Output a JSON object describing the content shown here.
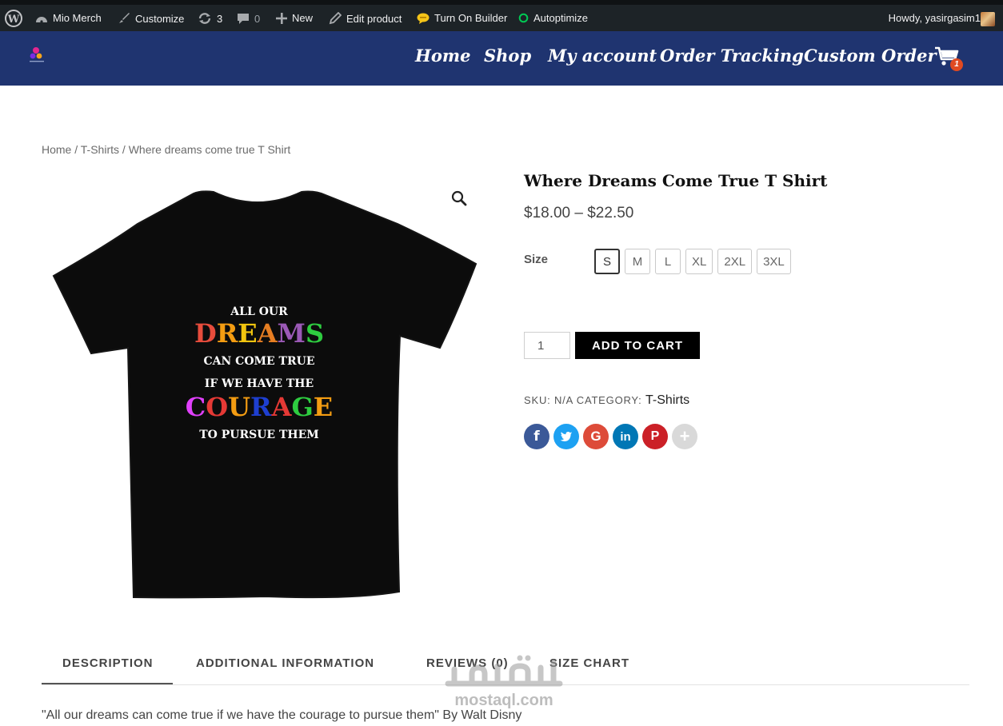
{
  "admin_bar": {
    "wp_logo": "wordpress-icon",
    "site_name": "Mio Merch",
    "customize": "Customize",
    "updates_count": "3",
    "comments_count": "0",
    "new": "New",
    "edit_product": "Edit product",
    "builder": "Turn On Builder",
    "autoptimize": "Autoptimize",
    "howdy": "Howdy, yasirgasim1"
  },
  "nav": {
    "items": [
      "Home",
      "Shop",
      "My account",
      "Order Tracking",
      "Custom Order"
    ],
    "cart_count": "1",
    "cart_icon": "shopping-cart-icon"
  },
  "breadcrumb": {
    "home": "Home",
    "sep": " / ",
    "category": "T-Shirts",
    "current": "Where dreams come true T Shirt"
  },
  "product": {
    "image_text": {
      "line1": "ALL OUR",
      "line2": [
        "D",
        "R",
        "E",
        "A",
        "M",
        "S"
      ],
      "line3": "CAN COME TRUE",
      "line4": "IF WE HAVE THE",
      "line5": [
        "C",
        "O",
        "U",
        "R",
        "A",
        "G",
        "E"
      ],
      "line6": "TO PURSUE THEM"
    },
    "title": "Where Dreams Come True T Shirt",
    "price": "$18.00 – $22.50",
    "size_label": "Size",
    "sizes": [
      "S",
      "M",
      "L",
      "XL",
      "2XL",
      "3XL"
    ],
    "selected_size": "S",
    "quantity": "1",
    "add_to_cart": "ADD TO CART",
    "sku_label": "SKU:",
    "sku_value": "N/A",
    "category_label": "CATEGORY:",
    "category_value": "T-Shirts"
  },
  "share": [
    {
      "icon": "facebook-icon",
      "glyph": "f",
      "color": "#3b5998"
    },
    {
      "icon": "twitter-icon",
      "glyph": "t",
      "color": "#1da1f2"
    },
    {
      "icon": "google-plus-icon",
      "glyph": "G",
      "color": "#dd4b39"
    },
    {
      "icon": "linkedin-icon",
      "glyph": "in",
      "color": "#0077b5"
    },
    {
      "icon": "pinterest-icon",
      "glyph": "P",
      "color": "#cb2027"
    },
    {
      "icon": "more-share-icon",
      "glyph": "+",
      "color": "#d9d9d9"
    }
  ],
  "tabs": [
    "DESCRIPTION",
    "ADDITIONAL INFORMATION",
    "REVIEWS (0)",
    "SIZE CHART"
  ],
  "description": "\"All our dreams can come true if we have the courage to pursue them\" By Walt Disny",
  "watermark": {
    "arabic": "مستقل",
    "latin": "mostaql.com"
  },
  "colors": {
    "admin_bar": "#1d2327",
    "nav_bg": "#1f3470",
    "cart_badge": "#e04a21",
    "button": "#000000"
  }
}
